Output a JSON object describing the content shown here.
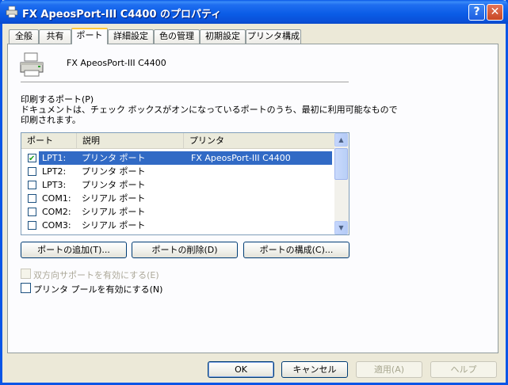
{
  "window": {
    "title": "FX ApeosPort-III C4400 のプロパティ",
    "help_label": "?",
    "close_label": "✕"
  },
  "tabs": [
    {
      "label": "全般"
    },
    {
      "label": "共有"
    },
    {
      "label": "ポート"
    },
    {
      "label": "詳細設定"
    },
    {
      "label": "色の管理"
    },
    {
      "label": "初期設定"
    },
    {
      "label": "プリンタ構成"
    }
  ],
  "printer": {
    "name": "FX ApeosPort-III C4400"
  },
  "ports_section": {
    "label": "印刷するポート(P)",
    "description_line1": "ドキュメントは、チェック ボックスがオンになっているポートのうち、最初に利用可能なもので",
    "description_line2": "印刷されます。"
  },
  "ports_table": {
    "columns": [
      "ポート",
      "説明",
      "プリンタ"
    ],
    "rows": [
      {
        "port": "LPT1:",
        "desc": "プリンタ ポート",
        "printer": "FX ApeosPort-III C4400",
        "checked": true,
        "selected": true
      },
      {
        "port": "LPT2:",
        "desc": "プリンタ ポート",
        "printer": "",
        "checked": false,
        "selected": false
      },
      {
        "port": "LPT3:",
        "desc": "プリンタ ポート",
        "printer": "",
        "checked": false,
        "selected": false
      },
      {
        "port": "COM1:",
        "desc": "シリアル ポート",
        "printer": "",
        "checked": false,
        "selected": false
      },
      {
        "port": "COM2:",
        "desc": "シリアル ポート",
        "printer": "",
        "checked": false,
        "selected": false
      },
      {
        "port": "COM3:",
        "desc": "シリアル ポート",
        "printer": "",
        "checked": false,
        "selected": false
      }
    ]
  },
  "port_buttons": {
    "add": "ポートの追加(T)...",
    "delete": "ポートの削除(D)",
    "configure": "ポートの構成(C)..."
  },
  "options": {
    "bidirectional": "双方向サポートを有効にする(E)",
    "pooling": "プリンタ プールを有効にする(N)"
  },
  "dialog_buttons": {
    "ok": "OK",
    "cancel": "キャンセル",
    "apply": "適用(A)",
    "help": "ヘルプ"
  },
  "colors": {
    "titlebar": "#0A5CE6",
    "selection": "#316AC5",
    "face": "#ECE9D8"
  }
}
